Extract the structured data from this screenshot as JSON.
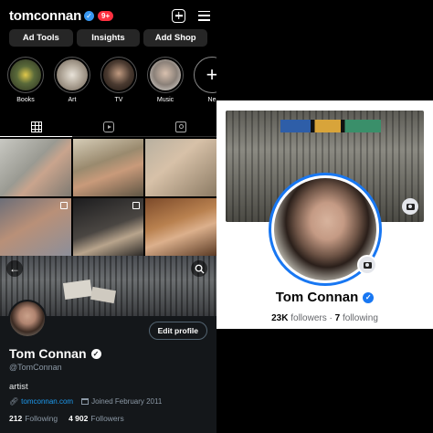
{
  "instagram": {
    "username": "tomconnan",
    "notification_badge": "9+",
    "buttons": [
      "Ad Tools",
      "Insights",
      "Add Shop"
    ],
    "highlights": [
      {
        "label": "Books",
        "color": "#5a6a3a"
      },
      {
        "label": "Art",
        "color": "#b2a89a"
      },
      {
        "label": "TV",
        "color": "#4a3a30"
      },
      {
        "label": "Music",
        "color": "#8a8078"
      },
      {
        "label": "Ne",
        "color": "#000000"
      }
    ],
    "tabs": [
      "grid-icon",
      "reels-icon",
      "tagged-icon"
    ]
  },
  "twitter": {
    "edit_profile": "Edit profile",
    "name": "Tom Connan",
    "handle": "@TomConnan",
    "bio": "artist",
    "website": "tomconnan.com",
    "joined": "Joined February 2011",
    "following_count": "212",
    "following_label": "Following",
    "followers_count": "4 902",
    "followers_label": "Followers"
  },
  "facebook": {
    "name": "Tom Connan",
    "followers_count": "23K",
    "followers_label": "followers",
    "separator": "·",
    "following_count": "7",
    "following_label": "following",
    "accent_color": "#1877f2"
  }
}
